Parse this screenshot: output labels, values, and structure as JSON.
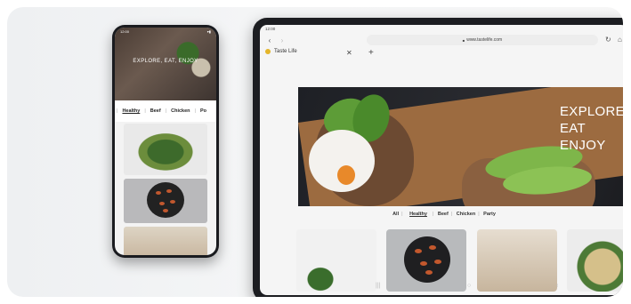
{
  "phone": {
    "status_time": "12:00",
    "status_icons": "▾▮",
    "hero_text": "EXPLORE, EAT, ENJOY",
    "categories": [
      {
        "label": "Healthy",
        "active": true
      },
      {
        "label": "Beef"
      },
      {
        "label": "Chicken"
      },
      {
        "label": "Po"
      }
    ]
  },
  "tablet": {
    "status_time": "12:00",
    "url": "www.tastelife.com",
    "tab_title": "Taste Life",
    "hero_lines": [
      "EXPLORE",
      "EAT",
      "ENJOY"
    ],
    "categories": [
      {
        "label": "All"
      },
      {
        "label": "Healthy",
        "active": true
      },
      {
        "label": "Beef"
      },
      {
        "label": "Chicken"
      },
      {
        "label": "Party"
      }
    ],
    "icons": {
      "back": "‹",
      "forward": "›",
      "lock": "🔒",
      "reload": "↻",
      "home": "⌂",
      "close": "✕",
      "add": "+",
      "nav_recent": "|||",
      "nav_home": "○",
      "nav_back": "‹"
    }
  },
  "colors": {
    "accent_yolk": "#e8892a",
    "avocado": "#5d9c37",
    "favicon": "#e4b52a"
  }
}
